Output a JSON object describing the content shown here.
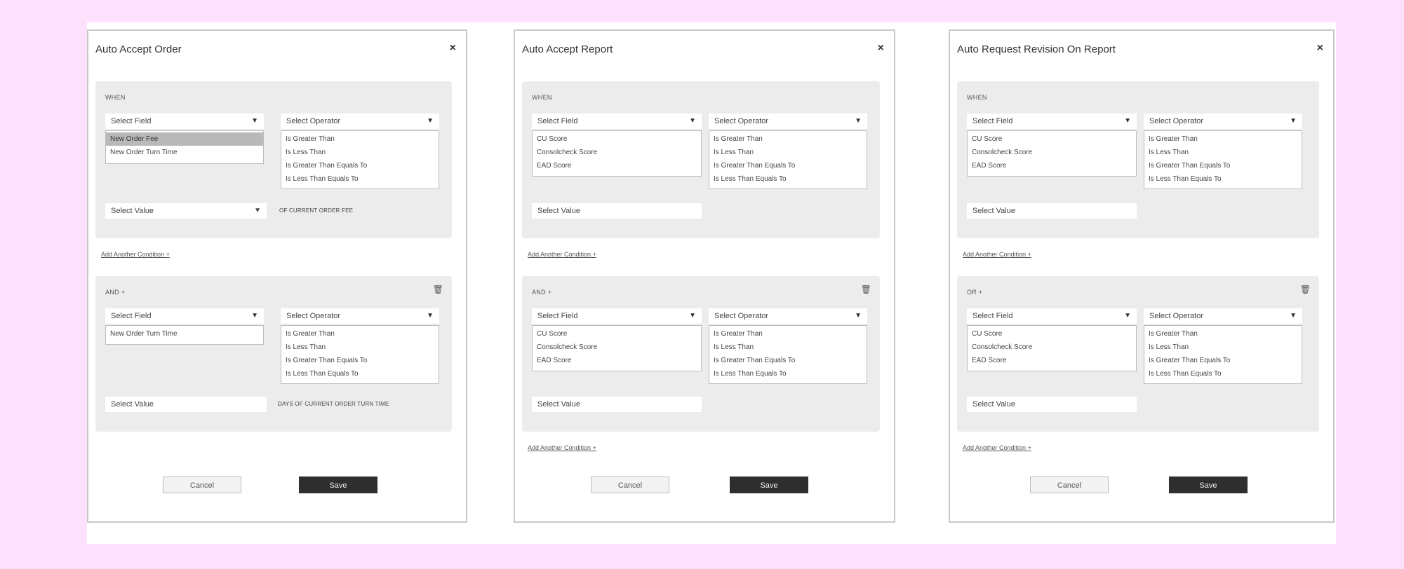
{
  "modals": [
    {
      "title": "Auto Accept Order",
      "close": "×",
      "when": {
        "label": "WHEN",
        "field": "Select Field",
        "operator": "Select Operator",
        "field_options": [
          "New Order Fee",
          "New Order Turn Time"
        ],
        "operator_options": [
          "Is Greater Than",
          "Is Less Than",
          "Is Greater Than Equals To",
          "Is Less Than Equals To"
        ],
        "value_placeholder": "Select Value",
        "suffix": "OF CURRENT ORDER FEE"
      },
      "add_link_1": "Add Another Condition +",
      "and": {
        "label": "AND +",
        "field": "Select Field",
        "operator": "Select Operator",
        "field_options": [
          "New Order Turn Time"
        ],
        "operator_options": [
          "Is Greater Than",
          "Is Less Than",
          "Is Greater Than Equals To",
          "Is Less Than Equals To"
        ],
        "value_placeholder": "Select Value",
        "suffix": "DAYS OF CURRENT ORDER TURN TIME"
      },
      "cancel": "Cancel",
      "save": "Save"
    },
    {
      "title": "Auto Accept Report",
      "close": "×",
      "when": {
        "label": "WHEN",
        "field": "Select Field",
        "operator": "Select Operator",
        "field_options": [
          "CU Score",
          "Consolcheck Score",
          "EAD Score"
        ],
        "operator_options": [
          "Is Greater Than",
          "Is Less Than",
          "Is Greater Than Equals To",
          "Is Less Than Equals To"
        ],
        "value_placeholder": "Select Value"
      },
      "add_link_1": "Add Another Condition +",
      "and": {
        "label": "AND +",
        "field": "Select Field",
        "operator": "Select Operator",
        "field_options": [
          "CU Score",
          "Consolcheck Score",
          "EAD Score"
        ],
        "operator_options": [
          "Is Greater Than",
          "Is Less Than",
          "Is Greater Than Equals To",
          "Is Less Than Equals To"
        ],
        "value_placeholder": "Select Value"
      },
      "add_link_2": "Add Another Condition +",
      "cancel": "Cancel",
      "save": "Save"
    },
    {
      "title": "Auto Request Revision On Report",
      "close": "×",
      "when": {
        "label": "WHEN",
        "field": "Select Field",
        "operator": "Select Operator",
        "field_options": [
          "CU Score",
          "Consolcheck Score",
          "EAD Score"
        ],
        "operator_options": [
          "Is Greater Than",
          "Is Less Than",
          "Is Greater Than Equals To",
          "Is Less Than Equals To"
        ],
        "value_placeholder": "Select Value"
      },
      "add_link_1": "Add Another Condition +",
      "and": {
        "label": "OR +",
        "field": "Select Field",
        "operator": "Select Operator",
        "field_options": [
          "CU Score",
          "Consolcheck Score",
          "EAD Score"
        ],
        "operator_options": [
          "Is Greater Than",
          "Is Less Than",
          "Is Greater Than Equals To",
          "Is Less Than Equals To"
        ],
        "value_placeholder": "Select Value"
      },
      "add_link_2": "Add Another Condition +",
      "cancel": "Cancel",
      "save": "Save"
    }
  ]
}
